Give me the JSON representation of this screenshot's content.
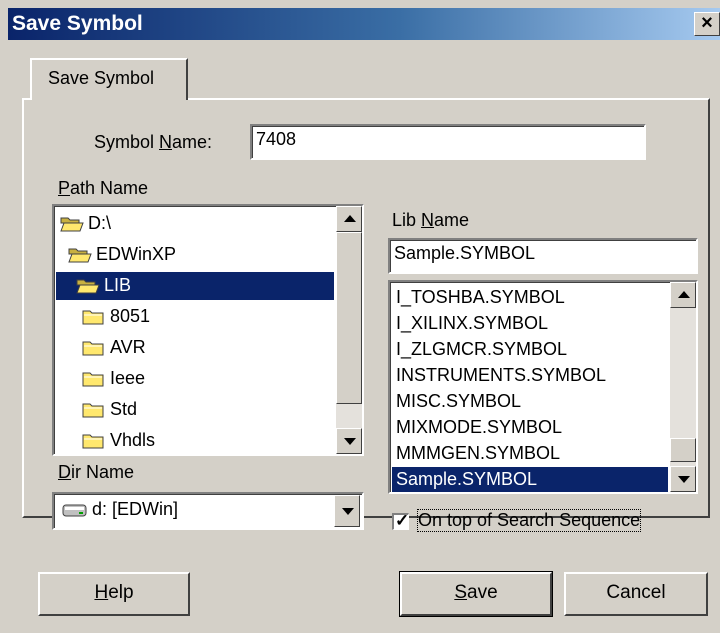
{
  "window": {
    "title": "Save Symbol",
    "close_label": "×"
  },
  "tab": {
    "label": "Save Symbol"
  },
  "symbol_name": {
    "label_pre": "Symbol ",
    "label_u": "N",
    "label_post": "ame:",
    "value": "7408"
  },
  "path_name": {
    "label_u": "P",
    "label_post": "ath Name",
    "items": [
      {
        "label": "D:\\",
        "indent": 0,
        "icon": "open-folder-icon",
        "selected": false
      },
      {
        "label": "EDWinXP",
        "indent": 1,
        "icon": "open-folder-icon",
        "selected": false
      },
      {
        "label": "LIB",
        "indent": 2,
        "icon": "open-folder-icon",
        "selected": true
      },
      {
        "label": "8051",
        "indent": 3,
        "icon": "folder-icon",
        "selected": false
      },
      {
        "label": "AVR",
        "indent": 3,
        "icon": "folder-icon",
        "selected": false
      },
      {
        "label": "Ieee",
        "indent": 3,
        "icon": "folder-icon",
        "selected": false
      },
      {
        "label": "Std",
        "indent": 3,
        "icon": "folder-icon",
        "selected": false
      },
      {
        "label": "Vhdls",
        "indent": 3,
        "icon": "folder-icon",
        "selected": false
      }
    ]
  },
  "dir_name": {
    "label_u": "D",
    "label_post": "ir Name",
    "value": "d: [EDWin]"
  },
  "lib_name": {
    "label_pre": "Lib ",
    "label_u": "N",
    "label_post": "ame",
    "value": "Sample.SYMBOL",
    "items": [
      {
        "label": "I_TOSHBA.SYMBOL",
        "selected": false
      },
      {
        "label": "I_XILINX.SYMBOL",
        "selected": false
      },
      {
        "label": "I_ZLGMCR.SYMBOL",
        "selected": false
      },
      {
        "label": "INSTRUMENTS.SYMBOL",
        "selected": false
      },
      {
        "label": "MISC.SYMBOL",
        "selected": false
      },
      {
        "label": "MIXMODE.SYMBOL",
        "selected": false
      },
      {
        "label": "MMMGEN.SYMBOL",
        "selected": false
      },
      {
        "label": "Sample.SYMBOL",
        "selected": true
      }
    ]
  },
  "on_top": {
    "label": "On top of Search Sequence",
    "checked": true
  },
  "buttons": {
    "help_u": "H",
    "help_post": "elp",
    "save_u": "S",
    "save_post": "ave",
    "cancel": "Cancel"
  },
  "colors": {
    "face": "#d4d0c8",
    "selection": "#0a246a",
    "title_start": "#0a246a",
    "title_end": "#a6caf0",
    "folder": "#ffe86e"
  }
}
